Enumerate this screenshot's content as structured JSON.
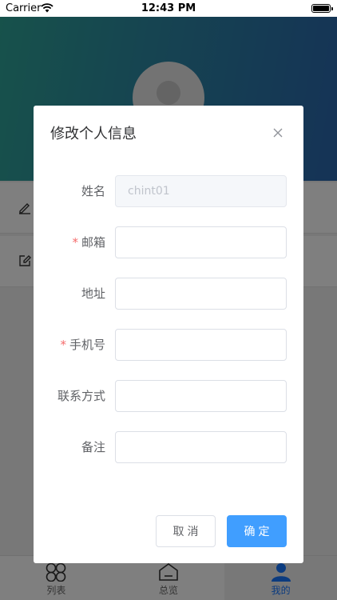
{
  "status_bar": {
    "carrier": "Carrier",
    "time": "12:43 PM"
  },
  "tabbar": {
    "items": [
      {
        "label": "列表",
        "icon": "grid-icon",
        "active": false
      },
      {
        "label": "总览",
        "icon": "home-icon",
        "active": false
      },
      {
        "label": "我的",
        "icon": "user-icon",
        "active": true
      }
    ]
  },
  "dialog": {
    "title": "修改个人信息",
    "fields": [
      {
        "label": "姓名",
        "required": false,
        "value": "chint01",
        "disabled": true
      },
      {
        "label": "邮箱",
        "required": true,
        "value": ""
      },
      {
        "label": "地址",
        "required": false,
        "value": ""
      },
      {
        "label": "手机号",
        "required": true,
        "value": ""
      },
      {
        "label": "联系方式",
        "required": false,
        "value": ""
      },
      {
        "label": "备注",
        "required": false,
        "value": ""
      }
    ],
    "required_mark": "*",
    "cancel_label": "取消",
    "ok_label": "确定"
  },
  "colors": {
    "primary": "#409eff",
    "header_start": "#2fa497",
    "header_end": "#2a66ad",
    "required": "#f56c6c"
  }
}
